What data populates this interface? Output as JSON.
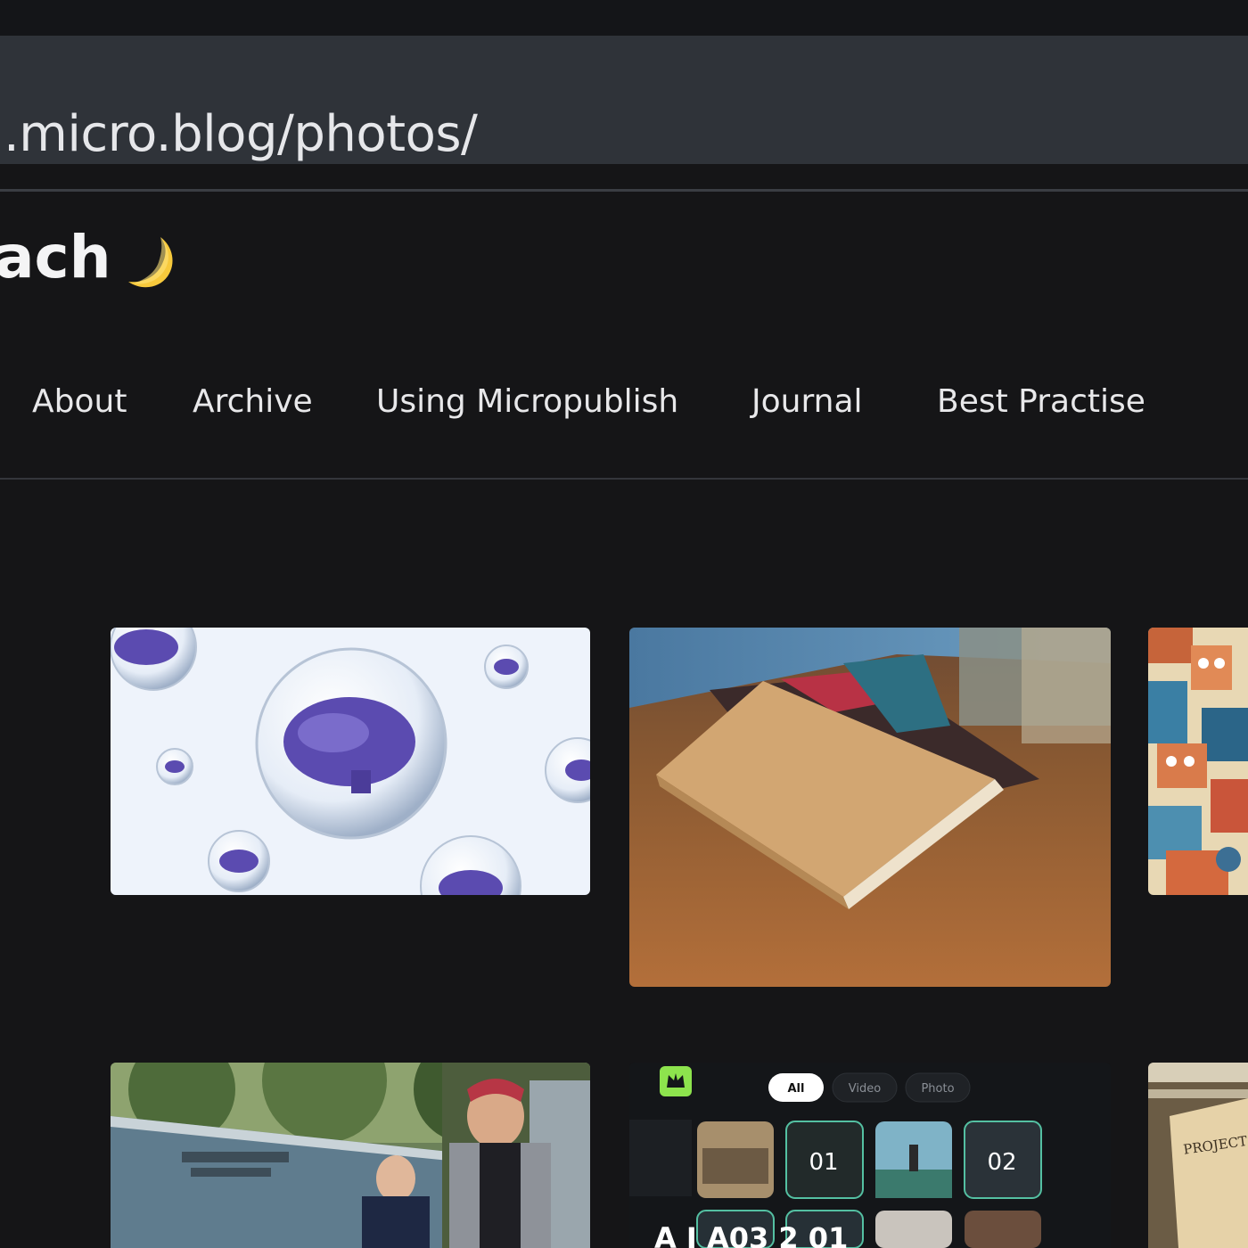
{
  "browser": {
    "url": ".micro.blog/photos/"
  },
  "site": {
    "title": "ach",
    "emoji": "moon-icon"
  },
  "nav": {
    "items": [
      "About",
      "Archive",
      "Using Micropublish",
      "Journal",
      "Best Practise"
    ]
  },
  "photos": [
    {
      "name": "brain-bubbles"
    },
    {
      "name": "notebook-on-table"
    },
    {
      "name": "robots-pattern"
    },
    {
      "name": "school-wall"
    },
    {
      "name": "video-app-ui",
      "tabs": [
        "All",
        "Video",
        "Photo"
      ],
      "tiles": [
        "01",
        "02"
      ],
      "bottom_text": "A I A03  2 01"
    },
    {
      "name": "handwritten-note",
      "note_text": "PROJECT DATABASE"
    }
  ],
  "colors": {
    "background": "#151517",
    "urlbar": "#2f3339",
    "accent": "#8de34d"
  }
}
